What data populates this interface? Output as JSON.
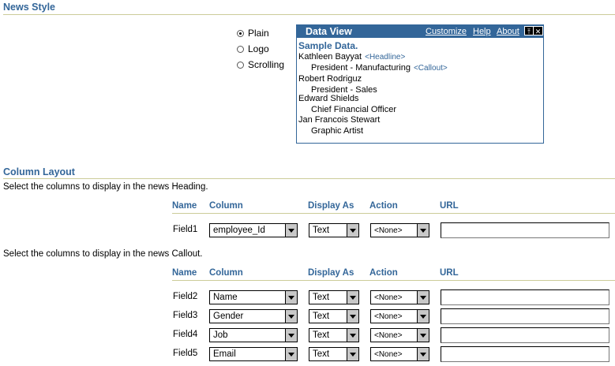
{
  "news_style": {
    "title": "News Style",
    "options": [
      {
        "label": "Plain",
        "checked": true
      },
      {
        "label": "Logo",
        "checked": false
      },
      {
        "label": "Scrolling",
        "checked": false
      }
    ]
  },
  "data_view": {
    "title": "Data View",
    "links": [
      "Customize",
      "Help",
      "About"
    ],
    "controls": [
      "pin-icon",
      "close-icon"
    ],
    "sample_label": "Sample Data.",
    "rows": [
      {
        "text": "Kathleen Bayyat",
        "tag": "<Headline>"
      },
      {
        "text": "President - Manufacturing",
        "tag": "<Callout>"
      },
      {
        "text": "Robert Rodriguz",
        "tag": ""
      },
      {
        "text": "President - Sales",
        "tag": ""
      },
      {
        "text": "Edward Shields",
        "tag": ""
      },
      {
        "text": "Chief Financial Officer",
        "tag": ""
      },
      {
        "text": "Jan Francois Stewart",
        "tag": ""
      },
      {
        "text": "Graphic Artist",
        "tag": ""
      }
    ]
  },
  "column_layout": {
    "title": "Column Layout",
    "heading_instruction": "Select the columns to display in the news Heading.",
    "callout_instruction": "Select the columns to display in the news Callout.",
    "headers": {
      "name": "Name",
      "column": "Column",
      "display_as": "Display As",
      "action": "Action",
      "url": "URL"
    },
    "heading_fields": [
      {
        "name": "Field1",
        "column": "employee_Id",
        "display_as": "Text",
        "action": "<None>",
        "url": ""
      }
    ],
    "callout_fields": [
      {
        "name": "Field2",
        "column": "Name",
        "display_as": "Text",
        "action": "<None>",
        "url": ""
      },
      {
        "name": "Field3",
        "column": "Gender",
        "display_as": "Text",
        "action": "<None>",
        "url": ""
      },
      {
        "name": "Field4",
        "column": "Job",
        "display_as": "Text",
        "action": "<None>",
        "url": ""
      },
      {
        "name": "Field5",
        "column": "Email",
        "display_as": "Text",
        "action": "<None>",
        "url": ""
      }
    ]
  },
  "colors": {
    "accent": "#336699",
    "rule": "#cccc99"
  }
}
